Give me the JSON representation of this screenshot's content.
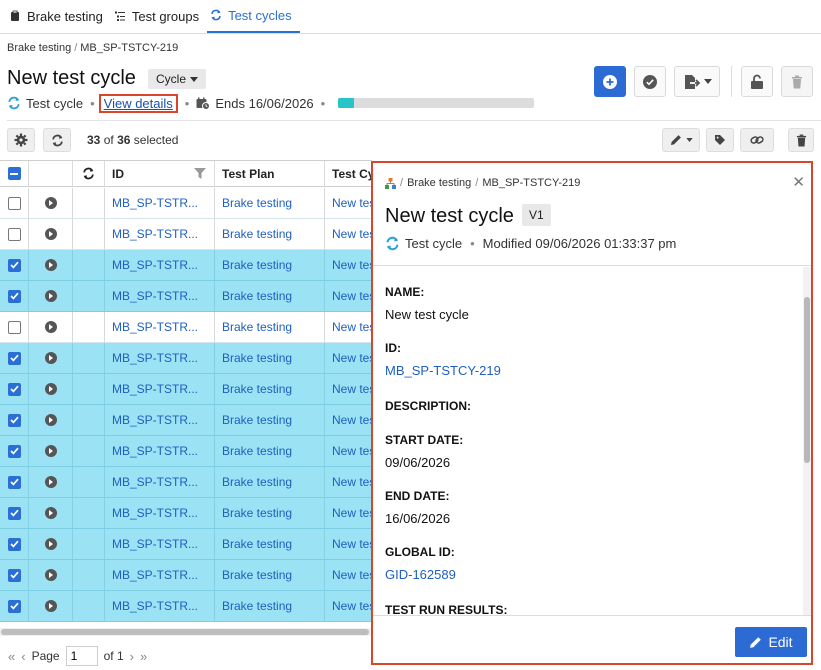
{
  "tabs": [
    {
      "label": "Brake testing",
      "icon": "clipboard-icon"
    },
    {
      "label": "Test groups",
      "icon": "list-tree-icon"
    },
    {
      "label": "Test cycles",
      "icon": "refresh-icon",
      "active": true
    }
  ],
  "breadcrumb": {
    "root": "Brake testing",
    "sep": "/",
    "current": "MB_SP-TSTCY-219"
  },
  "header": {
    "title": "New test cycle",
    "type_label": "Cycle",
    "item_type": "Test cycle",
    "view_details": "View details",
    "ends": "Ends 16/06/2026",
    "progress": 0.08,
    "dot": "•"
  },
  "toolbar": {
    "selected_count": "33",
    "of": "of",
    "total": "36",
    "selected": "selected"
  },
  "table": {
    "columns": [
      "ID",
      "Test Plan",
      "Test Cy"
    ],
    "rows": [
      {
        "checked": false,
        "id": "MB_SP-TSTR...",
        "plan": "Brake testing",
        "cycle": "New tes"
      },
      {
        "checked": false,
        "id": "MB_SP-TSTR...",
        "plan": "Brake testing",
        "cycle": "New tes"
      },
      {
        "checked": true,
        "id": "MB_SP-TSTR...",
        "plan": "Brake testing",
        "cycle": "New tes"
      },
      {
        "checked": true,
        "id": "MB_SP-TSTR...",
        "plan": "Brake testing",
        "cycle": "New tes"
      },
      {
        "checked": false,
        "id": "MB_SP-TSTR...",
        "plan": "Brake testing",
        "cycle": "New tes"
      },
      {
        "checked": true,
        "id": "MB_SP-TSTR...",
        "plan": "Brake testing",
        "cycle": "New tes"
      },
      {
        "checked": true,
        "id": "MB_SP-TSTR...",
        "plan": "Brake testing",
        "cycle": "New tes"
      },
      {
        "checked": true,
        "id": "MB_SP-TSTR...",
        "plan": "Brake testing",
        "cycle": "New tes"
      },
      {
        "checked": true,
        "id": "MB_SP-TSTR...",
        "plan": "Brake testing",
        "cycle": "New tes"
      },
      {
        "checked": true,
        "id": "MB_SP-TSTR...",
        "plan": "Brake testing",
        "cycle": "New tes"
      },
      {
        "checked": true,
        "id": "MB_SP-TSTR...",
        "plan": "Brake testing",
        "cycle": "New tes"
      },
      {
        "checked": true,
        "id": "MB_SP-TSTR...",
        "plan": "Brake testing",
        "cycle": "New tes"
      },
      {
        "checked": true,
        "id": "MB_SP-TSTR...",
        "plan": "Brake testing",
        "cycle": "New tes"
      },
      {
        "checked": true,
        "id": "MB_SP-TSTR...",
        "plan": "Brake testing",
        "cycle": "New tes"
      }
    ]
  },
  "pager": {
    "page_label": "Page",
    "page_value": "1",
    "of_label": "of 1"
  },
  "panel": {
    "breadcrumb_root": "Brake testing",
    "breadcrumb_sep": "/",
    "breadcrumb_current": "MB_SP-TSTCY-219",
    "title": "New test cycle",
    "version": "V1",
    "item_type": "Test cycle",
    "modified": "Modified 09/06/2026 01:33:37 pm",
    "dot": "•",
    "fields": {
      "name_label": "NAME:",
      "name_value": "New test cycle",
      "id_label": "ID:",
      "id_value": "MB_SP-TSTCY-219",
      "description_label": "DESCRIPTION:",
      "start_label": "START DATE:",
      "start_value": "09/06/2026",
      "end_label": "END DATE:",
      "end_value": "16/06/2026",
      "global_label": "GLOBAL ID:",
      "global_value": "GID-162589",
      "results_label": "TEST RUN RESULTS:"
    },
    "edit_label": "Edit"
  },
  "colors": {
    "accent": "#2c6bd3",
    "highlight": "#d8472b",
    "selected_row": "#9be3f4",
    "progress": "#28c4c8"
  }
}
